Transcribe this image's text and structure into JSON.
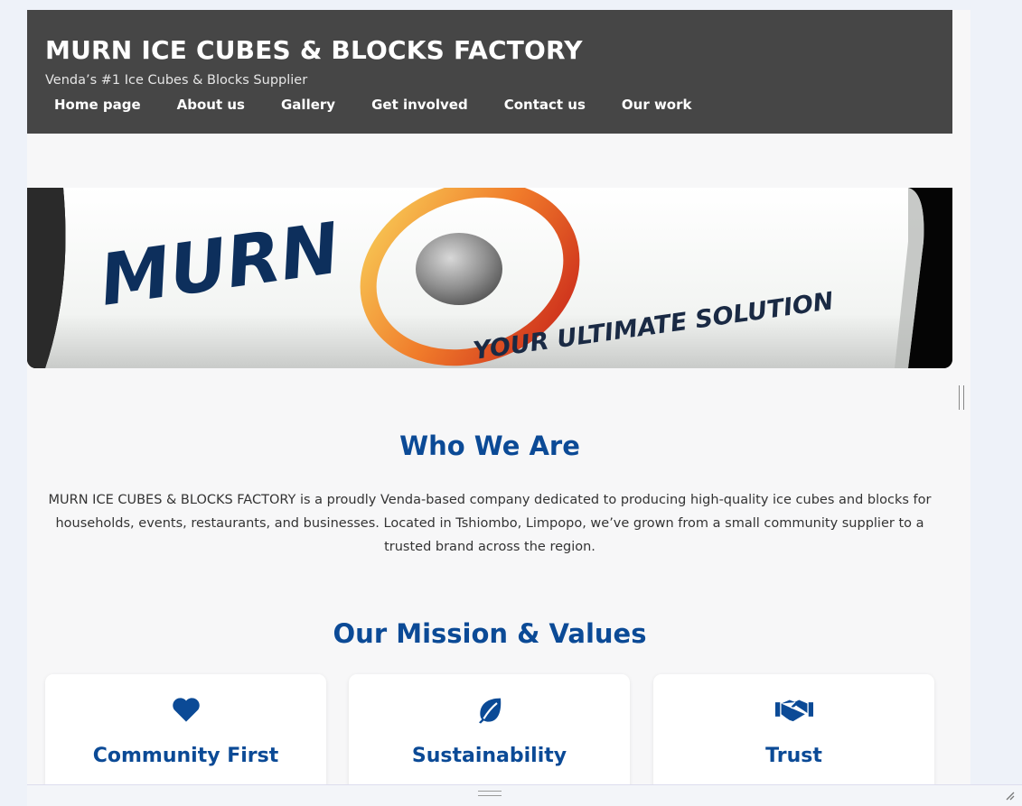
{
  "header": {
    "title": "MURN ICE CUBES & BLOCKS FACTORY",
    "tagline": "Venda’s #1 Ice Cubes & Blocks Supplier"
  },
  "nav": {
    "items": [
      {
        "label": "Home page"
      },
      {
        "label": "About us"
      },
      {
        "label": "Gallery"
      },
      {
        "label": "Get involved"
      },
      {
        "label": "Contact us"
      },
      {
        "label": "Our work"
      }
    ]
  },
  "banner": {
    "brand": "MURN",
    "slogan": "YOUR ULTIMATE SOLUTION"
  },
  "who_we_are": {
    "heading": "Who We Are",
    "text": "MURN ICE CUBES & BLOCKS FACTORY is a proudly Venda-based company dedicated to producing high-quality ice cubes and blocks for households, events, restaurants, and businesses. Located in Tshiombo, Limpopo, we’ve grown from a small community supplier to a trusted brand across the region."
  },
  "mission": {
    "heading": "Our Mission & Values",
    "cards": [
      {
        "icon": "heart-icon",
        "title": "Community First"
      },
      {
        "icon": "leaf-icon",
        "title": "Sustainability"
      },
      {
        "icon": "handshake-icon",
        "title": "Trust"
      }
    ]
  },
  "colors": {
    "header_bg": "#464646",
    "accent": "#0b4a96",
    "page_bg": "#f7f7f8"
  }
}
